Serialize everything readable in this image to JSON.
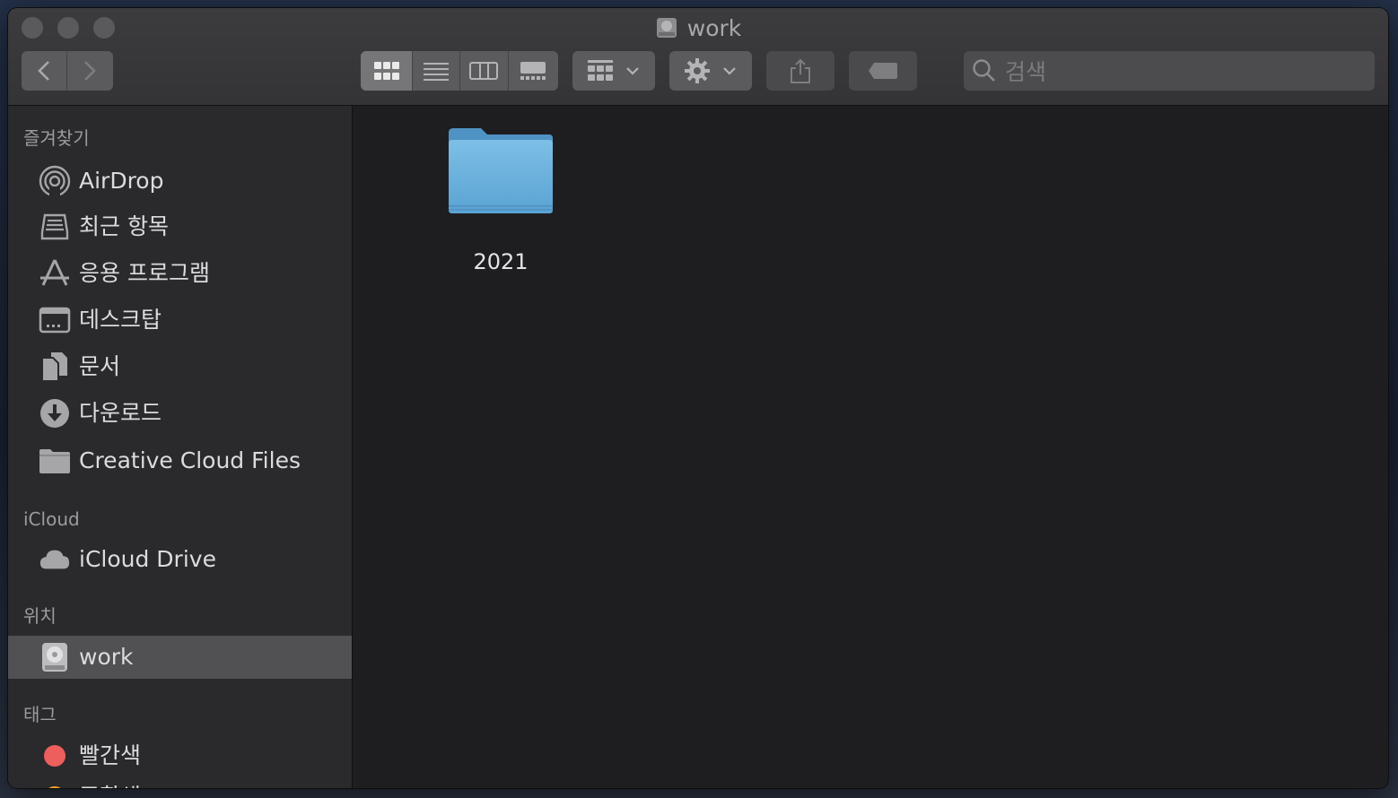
{
  "window": {
    "title": "work"
  },
  "toolbar": {
    "search_placeholder": "검색",
    "view_modes": [
      "icon-view",
      "list-view",
      "column-view",
      "gallery-view"
    ],
    "active_view": "icon-view"
  },
  "sidebar": {
    "sections": {
      "favorites": "즐겨찾기",
      "icloud": "iCloud",
      "locations": "위치",
      "tags": "태그"
    },
    "favorites": [
      {
        "label": "AirDrop",
        "icon": "airdrop-icon"
      },
      {
        "label": "최근 항목",
        "icon": "recents-icon"
      },
      {
        "label": "응용 프로그램",
        "icon": "applications-icon"
      },
      {
        "label": "데스크탑",
        "icon": "desktop-icon"
      },
      {
        "label": "문서",
        "icon": "documents-icon"
      },
      {
        "label": "다운로드",
        "icon": "downloads-icon"
      },
      {
        "label": "Creative Cloud Files",
        "icon": "folder-icon"
      }
    ],
    "icloud": [
      {
        "label": "iCloud Drive",
        "icon": "cloud-icon"
      }
    ],
    "locations": [
      {
        "label": "work",
        "icon": "disk-icon",
        "selected": true
      }
    ],
    "tags": [
      {
        "label": "빨간색",
        "color": "#ec5f5c"
      },
      {
        "label": "주황색",
        "color": "#f5a623"
      }
    ]
  },
  "content": {
    "items": [
      {
        "name": "2021",
        "icon": "folder-icon",
        "color": "#6fb1dd"
      }
    ]
  }
}
